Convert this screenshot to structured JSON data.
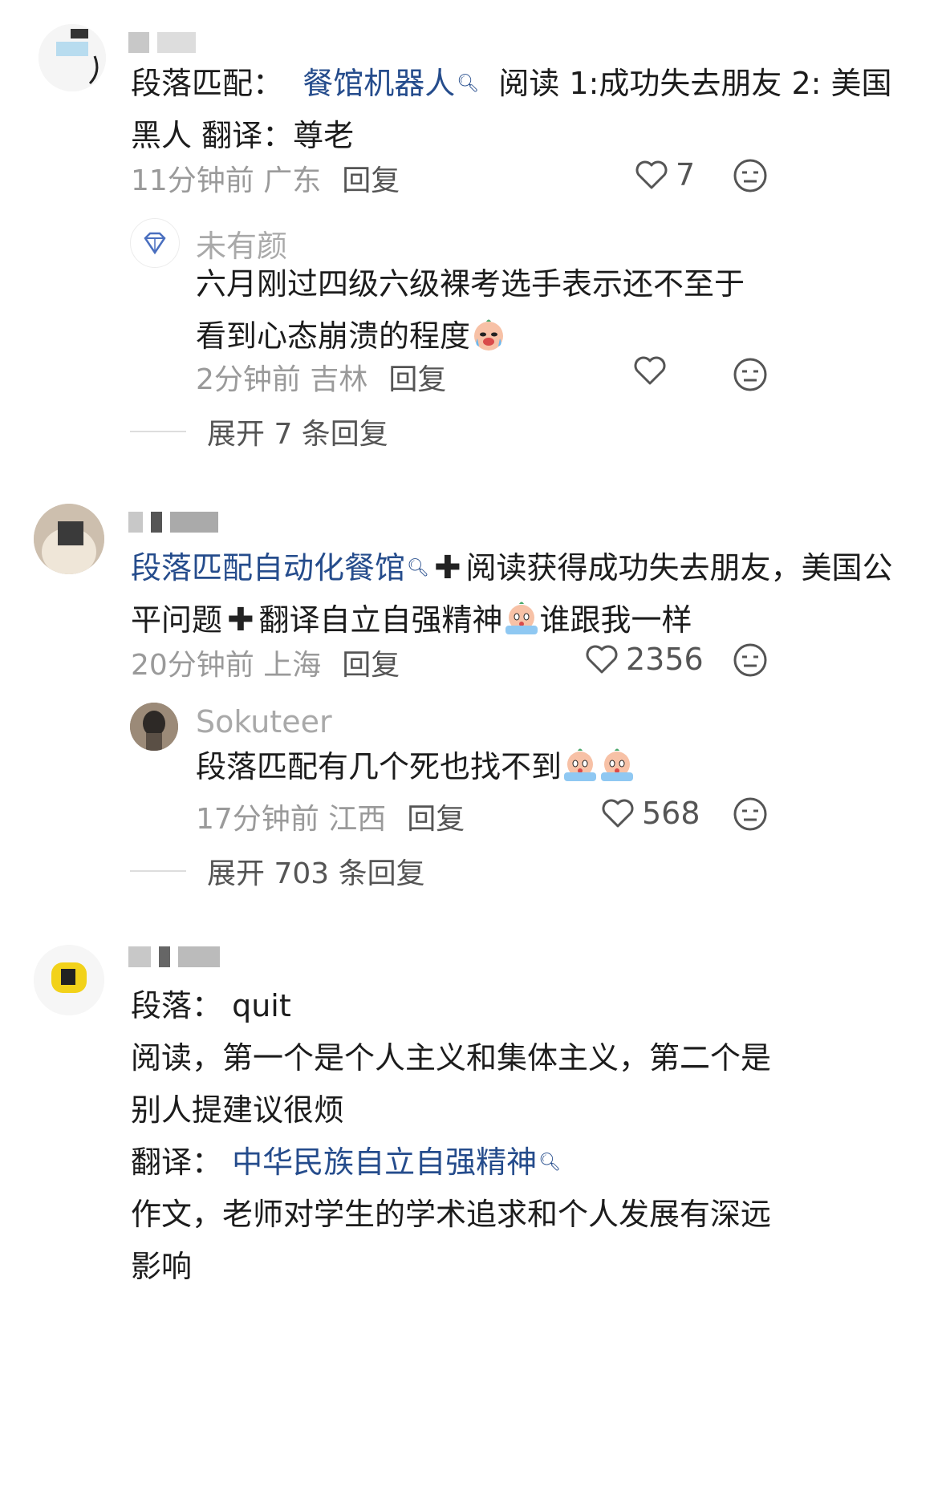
{
  "comments": [
    {
      "user": "",
      "text_parts": {
        "p1": "段落匹配：",
        "link1": "餐馆机器人",
        "p2": "阅读 1:成功失去朋友 2: 美国黑人 翻译：尊老"
      },
      "time_loc": "11分钟前 广东",
      "reply": "回复",
      "likes": "7",
      "sub": {
        "user": "未有颜",
        "text": "六月刚过四级六级裸考选手表示还不至于看到心态崩溃的程度",
        "time_loc": "2分钟前 吉林",
        "reply": "回复",
        "likes": ""
      },
      "expand": "展开 7 条回复"
    },
    {
      "user": "",
      "text_parts": {
        "link1": "段落匹配自动化餐馆",
        "p2": "阅读获得成功失去朋友，美国公平问题",
        "p3": "翻译自立自强精神",
        "p4": "谁跟我一样"
      },
      "time_loc": "20分钟前 上海",
      "reply": "回复",
      "likes": "2356",
      "sub": {
        "user": "Sokuteer",
        "text": "段落匹配有几个死也找不到",
        "time_loc": "17分钟前 江西",
        "reply": "回复",
        "likes": "568"
      },
      "expand": "展开 703 条回复"
    },
    {
      "user": "",
      "lines": {
        "l1": "段落：  quit",
        "l2": "阅读，第一个是个人主义和集体主义，第二个是别人提建议很烦",
        "l3a": "翻译：",
        "l3link": "中华民族自立自强精神",
        "l4": "作文，老师对学生的学术追求和个人发展有深远影响"
      }
    }
  ],
  "colors": {
    "link": "#254c8c",
    "meta": "#9a9a9a",
    "name": "#a9a9a9"
  },
  "icons": [
    "heart-icon",
    "dislike-face-icon",
    "diamond-icon",
    "crying-emoji-icon",
    "search-icon"
  ]
}
